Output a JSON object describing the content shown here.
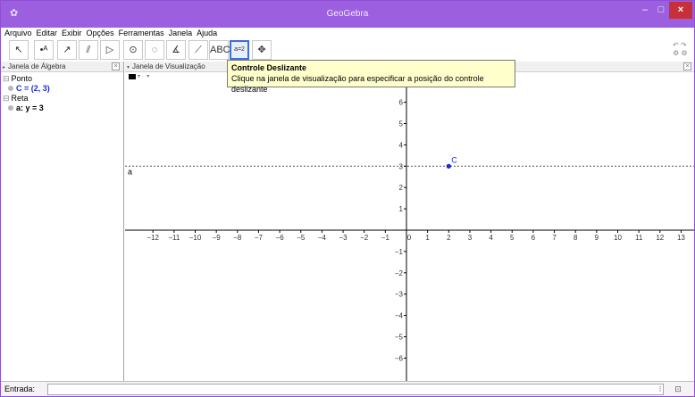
{
  "window": {
    "title": "GeoGebra"
  },
  "menu": [
    "Arquivo",
    "Editar",
    "Exibir",
    "Opções",
    "Ferramentas",
    "Janela",
    "Ajuda"
  ],
  "toolbar": {
    "tools": [
      {
        "name": "move-tool-icon",
        "glyph": "↖"
      },
      {
        "name": "point-tool-icon",
        "glyph": "•ᴬ"
      },
      {
        "name": "line-tool-icon",
        "glyph": "↗"
      },
      {
        "name": "perpendicular-tool-icon",
        "glyph": "⫽"
      },
      {
        "name": "polygon-tool-icon",
        "glyph": "▷"
      },
      {
        "name": "circle-tool-icon",
        "glyph": "⊙"
      },
      {
        "name": "conic-tool-icon",
        "glyph": "◌"
      },
      {
        "name": "angle-tool-icon",
        "glyph": "∡"
      },
      {
        "name": "reflect-tool-icon",
        "glyph": "⟋"
      },
      {
        "name": "text-tool-icon",
        "glyph": "ABC"
      },
      {
        "name": "slider-tool-icon",
        "glyph": "a=2"
      },
      {
        "name": "move-view-tool-icon",
        "glyph": "✥"
      }
    ],
    "active_index": 10
  },
  "algebra": {
    "header": "Janela de Álgebra",
    "groups": [
      {
        "category": "Ponto",
        "item": "C = (2, 3)",
        "color": "#1e2cd6"
      },
      {
        "category": "Reta",
        "item": "a: y = 3",
        "color": "#000000"
      }
    ]
  },
  "graphics": {
    "header": "Janela de Visualização",
    "point_label": "C",
    "line_label": "a"
  },
  "tooltip": {
    "title": "Controle Deslizante",
    "description": "Clique na janela de visualização para especificar a posição do controle deslizante"
  },
  "chart_data": {
    "type": "scatter",
    "x": [
      2
    ],
    "y": [
      3
    ],
    "xlim": [
      -13,
      13
    ],
    "ylim": [
      -6.5,
      6.5
    ],
    "x_ticks": [
      -12,
      -11,
      -10,
      -9,
      -8,
      -7,
      -6,
      -5,
      -4,
      -3,
      -2,
      -1,
      0,
      1,
      2,
      3,
      4,
      5,
      6,
      7,
      8,
      9,
      10,
      11,
      12,
      13
    ],
    "y_ticks": [
      -6,
      -5,
      -4,
      -3,
      -2,
      -1,
      1,
      2,
      3,
      4,
      5,
      6
    ],
    "horizontal_line_y": 3,
    "point_color": "#1e2cd6",
    "grid": false
  },
  "input": {
    "label": "Entrada:",
    "value": ""
  }
}
